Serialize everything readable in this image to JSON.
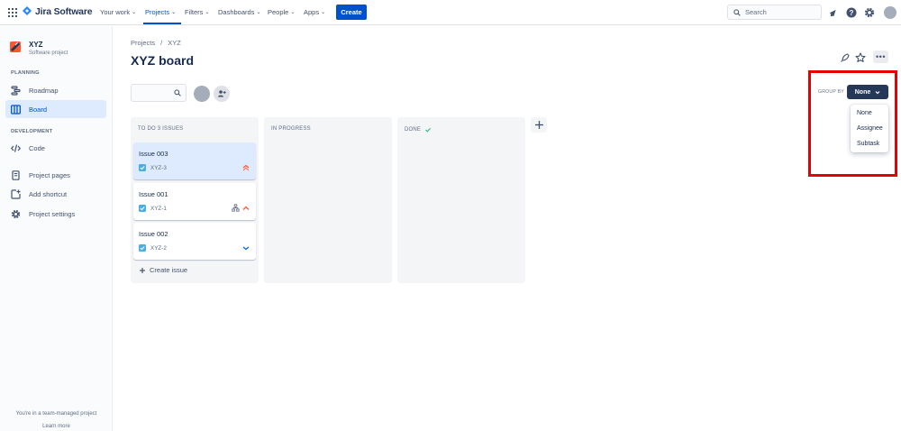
{
  "nav": {
    "product": "Jira Software",
    "items": [
      {
        "label": "Your work"
      },
      {
        "label": "Projects"
      },
      {
        "label": "Filters"
      },
      {
        "label": "Dashboards"
      },
      {
        "label": "People"
      },
      {
        "label": "Apps"
      }
    ],
    "create": "Create",
    "search_placeholder": "Search"
  },
  "sidebar": {
    "project_name": "XYZ",
    "project_type": "Software project",
    "planning_label": "PLANNING",
    "development_label": "DEVELOPMENT",
    "items": {
      "roadmap": "Roadmap",
      "board": "Board",
      "code": "Code",
      "project_pages": "Project pages",
      "add_shortcut": "Add shortcut",
      "project_settings": "Project settings"
    },
    "footer_text": "You're in a team-managed project",
    "footer_link": "Learn more"
  },
  "main": {
    "breadcrumb": [
      "Projects",
      "/",
      "XYZ"
    ],
    "title": "XYZ board",
    "group_by_label": "GROUP BY",
    "group_by_value": "None",
    "group_by_options": [
      "None",
      "Assignee",
      "Subtask"
    ]
  },
  "columns": [
    {
      "title": "TO DO 3 ISSUES",
      "cards": [
        {
          "title": "Issue 003",
          "key": "XYZ-3",
          "priority": "highest"
        },
        {
          "title": "Issue 001",
          "key": "XYZ-1",
          "priority": "high"
        },
        {
          "title": "Issue 002",
          "key": "XYZ-2",
          "priority": "low"
        }
      ],
      "create_label": "Create issue"
    },
    {
      "title": "IN PROGRESS"
    },
    {
      "title": "DONE"
    }
  ],
  "colors": {
    "brand_blue": "#0052cc",
    "highlight_red": "#e60000",
    "dark_button": "#253858"
  }
}
